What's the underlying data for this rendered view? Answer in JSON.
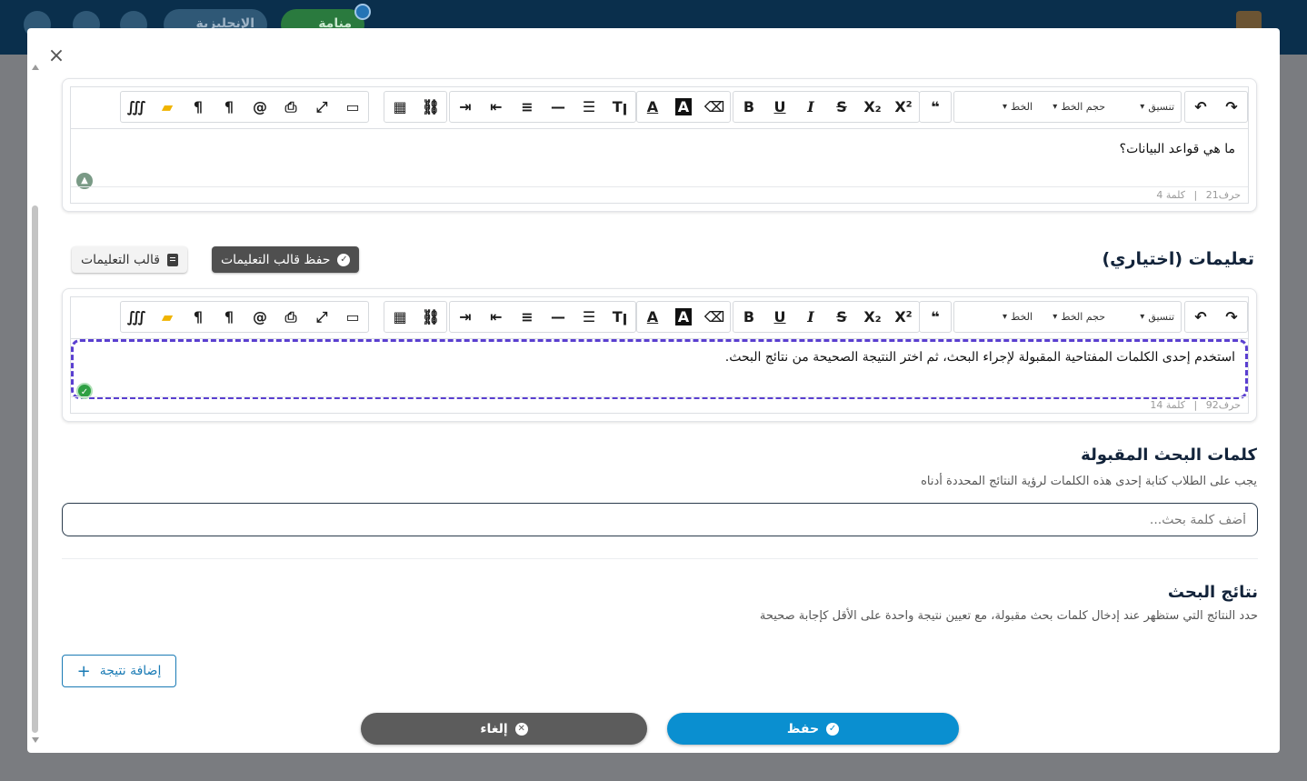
{
  "header": {
    "language_label": "الإنجليزية",
    "green_label": "منامة"
  },
  "modal": {
    "close_label": "×",
    "question_editor": {
      "toolbar": {
        "format_label": "تنسيق",
        "font_size_label": "حجم الخط",
        "font_label": "الخط"
      },
      "content": "ما هي قواعد البيانات؟",
      "status": {
        "chars": "حرف21",
        "sep": "|",
        "words": "كلمة 4"
      }
    },
    "instructions": {
      "title": "تعليمات (اختياري)",
      "save_template_label": "حفظ قالب التعليمات",
      "template_label": "قالب التعليمات",
      "editor": {
        "toolbar": {
          "format_label": "تنسيق",
          "font_size_label": "حجم الخط",
          "font_label": "الخط"
        },
        "content": "استخدم إحدى الكلمات المفتاحية المقبولة لإجراء البحث، ثم اختر النتيجة الصحيحة من نتائج البحث.",
        "status": {
          "chars": "حرف92",
          "sep": "|",
          "words": "كلمة 14"
        }
      }
    },
    "keywords": {
      "title": "كلمات البحث المقبولة",
      "description": "يجب على الطلاب كتابة إحدى هذه الكلمات لرؤية النتائج المحددة أدناه",
      "input_placeholder": "أضف كلمة بحث...",
      "input_value": ""
    },
    "results": {
      "title": "نتائج البحث",
      "description": "حدد النتائج التي ستظهر عند إدخال كلمات بحث مقبولة، مع تعيين نتيجة واحدة على الأقل كإجابة صحيحة",
      "add_label": "إضافة نتيجة"
    },
    "footer": {
      "cancel_label": "إلغاء",
      "save_label": "حفظ"
    }
  },
  "colors": {
    "accent": "#0a8fd0",
    "focus_outline": "#5a3fd0",
    "header_bg": "#0a2f4c"
  }
}
